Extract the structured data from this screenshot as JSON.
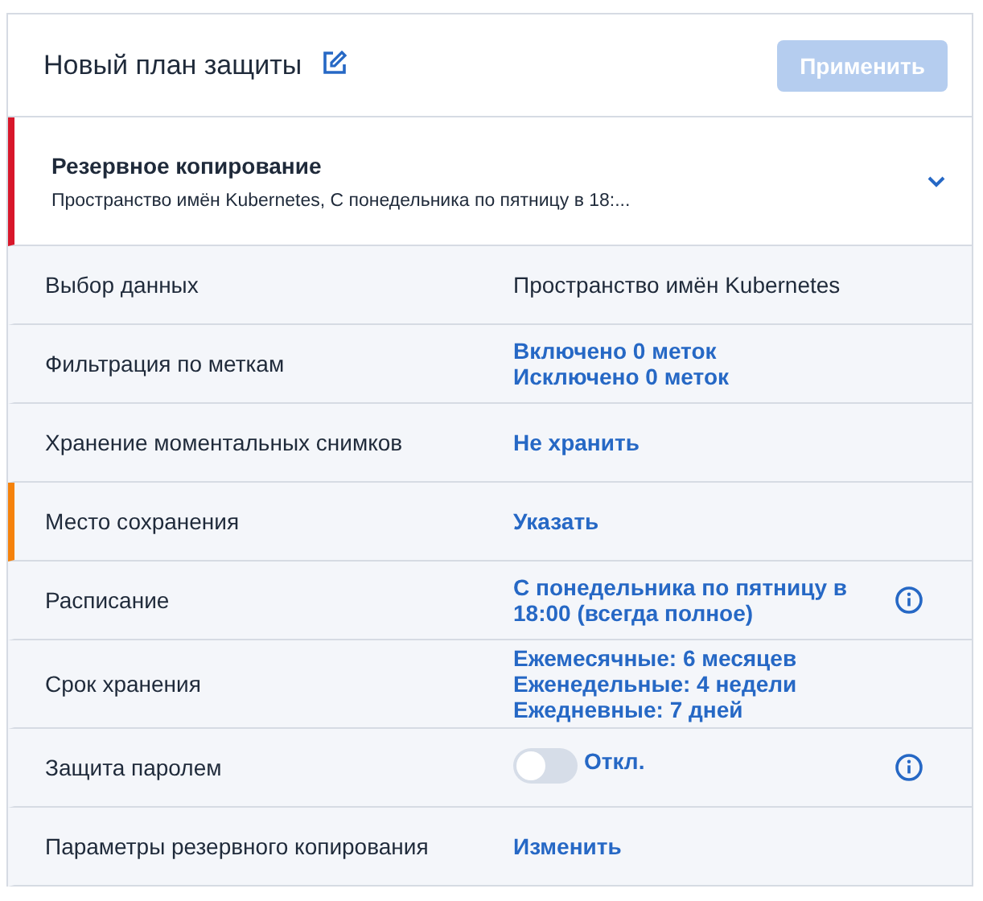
{
  "header": {
    "title": "Новый план защиты",
    "apply_button": {
      "label": "Применить",
      "disabled": true
    }
  },
  "section": {
    "title": "Резервное копирование",
    "summary": "Пространство имён Kubernetes, С понедельника по пятницу в 18:...",
    "error": true
  },
  "rows": [
    {
      "label": "Выбор данных",
      "kind": "text",
      "values": [
        "Пространство имён Kubernetes"
      ],
      "attention": false,
      "info": false
    },
    {
      "label": "Фильтрация по меткам",
      "kind": "link",
      "values": [
        "Включено 0 меток",
        "Исключено 0 меток"
      ],
      "attention": false,
      "info": false
    },
    {
      "label": "Хранение моментальных снимков",
      "kind": "link",
      "values": [
        "Не хранить"
      ],
      "attention": false,
      "info": false
    },
    {
      "label": "Место сохранения",
      "kind": "link",
      "values": [
        "Указать"
      ],
      "attention": true,
      "info": false
    },
    {
      "label": "Расписание",
      "kind": "link",
      "values": [
        "С понедельника по пятницу в 18:00 (всегда полное)"
      ],
      "attention": false,
      "info": true
    },
    {
      "label": "Срок хранения",
      "kind": "link",
      "values": [
        "Ежемесячные: 6 месяцев",
        "Еженедельные: 4 недели",
        "Ежедневные: 7 дней"
      ],
      "attention": false,
      "info": false
    },
    {
      "label": "Защита паролем",
      "kind": "toggle",
      "on": false,
      "values": [
        "Откл."
      ],
      "attention": false,
      "info": true
    },
    {
      "label": "Параметры резервного копирования",
      "kind": "link",
      "values": [
        "Изменить"
      ],
      "attention": false,
      "info": false
    }
  ]
}
